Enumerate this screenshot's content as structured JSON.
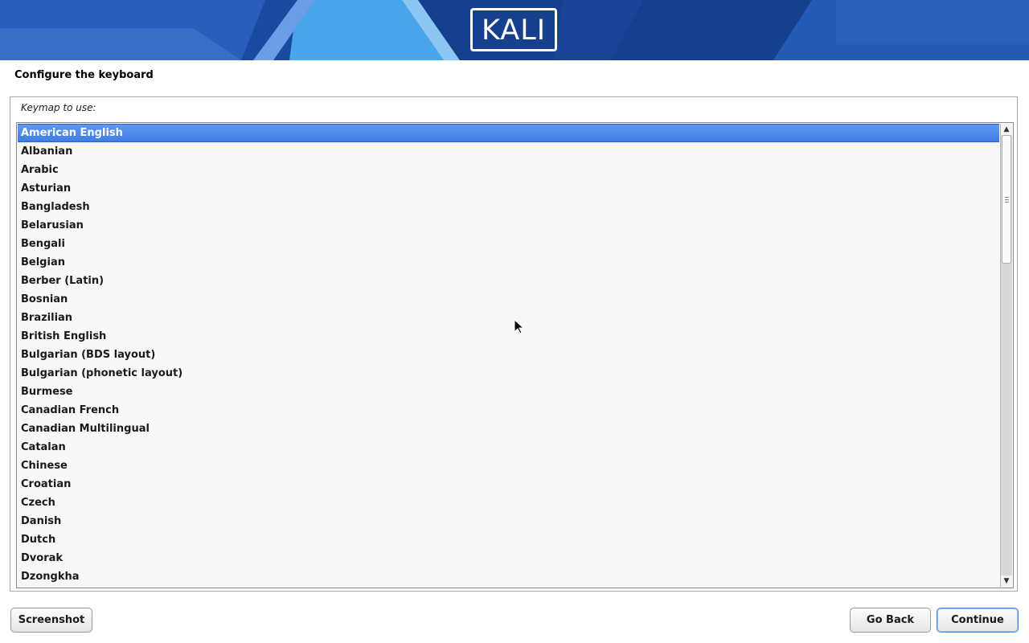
{
  "header": {
    "logo_text": "KALI",
    "colors": {
      "banner_base": "#1b4fa8",
      "accent_light": "#4ab0ee",
      "accent_dark": "#0f2f7a"
    }
  },
  "page": {
    "title": "Configure the keyboard"
  },
  "keymap": {
    "label": "Keymap to use:",
    "selected": "American English",
    "items": [
      "American English",
      "Albanian",
      "Arabic",
      "Asturian",
      "Bangladesh",
      "Belarusian",
      "Bengali",
      "Belgian",
      "Berber (Latin)",
      "Bosnian",
      "Brazilian",
      "British English",
      "Bulgarian (BDS layout)",
      "Bulgarian (phonetic layout)",
      "Burmese",
      "Canadian French",
      "Canadian Multilingual",
      "Catalan",
      "Chinese",
      "Croatian",
      "Czech",
      "Danish",
      "Dutch",
      "Dvorak",
      "Dzongkha"
    ],
    "selection_color": "#4a88ec"
  },
  "buttons": {
    "screenshot": "Screenshot",
    "go_back": "Go Back",
    "continue": "Continue"
  }
}
